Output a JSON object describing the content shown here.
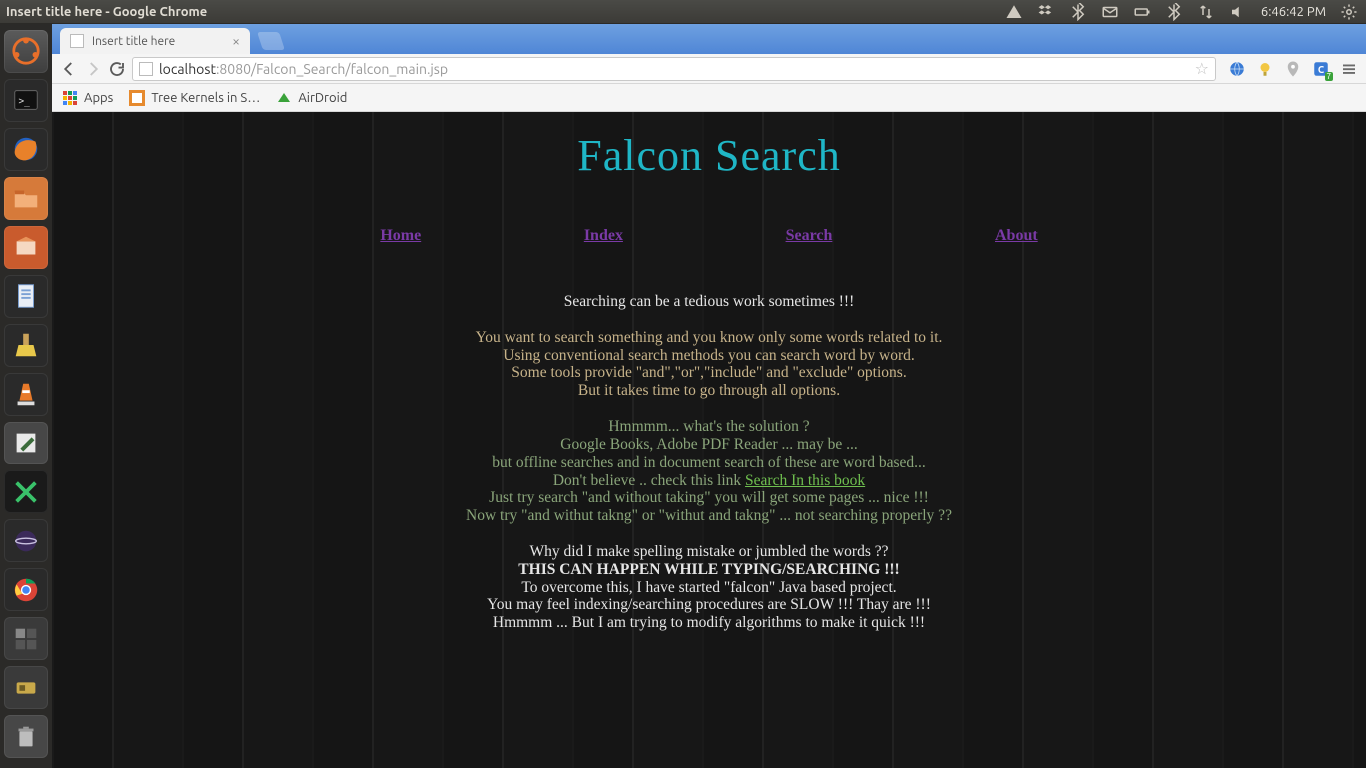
{
  "panel": {
    "title": "Insert title here - Google Chrome",
    "clock": "6:46:42 PM"
  },
  "browser": {
    "tab_title": "Insert title here",
    "url_host_prefix": "localhost",
    "url_rest": ":8080/Falcon_Search/falcon_main.jsp",
    "bookmarks": {
      "apps": "Apps",
      "treekernels": "Tree Kernels in S…",
      "airdroid": "AirDroid"
    }
  },
  "page": {
    "title": "Falcon Search",
    "nav": {
      "home": "Home",
      "index": "Index",
      "search": "Search",
      "about": "About"
    },
    "l1": "Searching can be a tedious work sometimes !!!",
    "l2": "You want to search something and you know only some words related to it.",
    "l3": "Using conventional search methods you can search word by word.",
    "l4": "Some tools provide \"and\",\"or\",\"include\" and \"exclude\" options.",
    "l5": "But it takes time to go through all options.",
    "l6": "Hmmmm... what's the solution ?",
    "l7": "Google Books, Adobe PDF Reader ... may be ...",
    "l8": "but offline searches and in document search of these are word based...",
    "l9a": "Don't believe .. check this link ",
    "l9link": "Search In this book",
    "l10": "Just try search \"and without taking\" you will get some pages ... nice !!!",
    "l11": "Now try \"and withut takng\" or \"withut and takng\" ... not searching properly ??",
    "l12": "Why did I make spelling mistake or jumbled the words ??",
    "l13": "THIS CAN HAPPEN WHILE TYPING/SEARCHING !!!",
    "l14": "To overcome this, I have started \"falcon\" Java based project.",
    "l15": "You may feel indexing/searching procedures are SLOW !!! Thay are !!!",
    "l16": "Hmmmm ... But I am trying to modify algorithms to make it quick !!!"
  }
}
